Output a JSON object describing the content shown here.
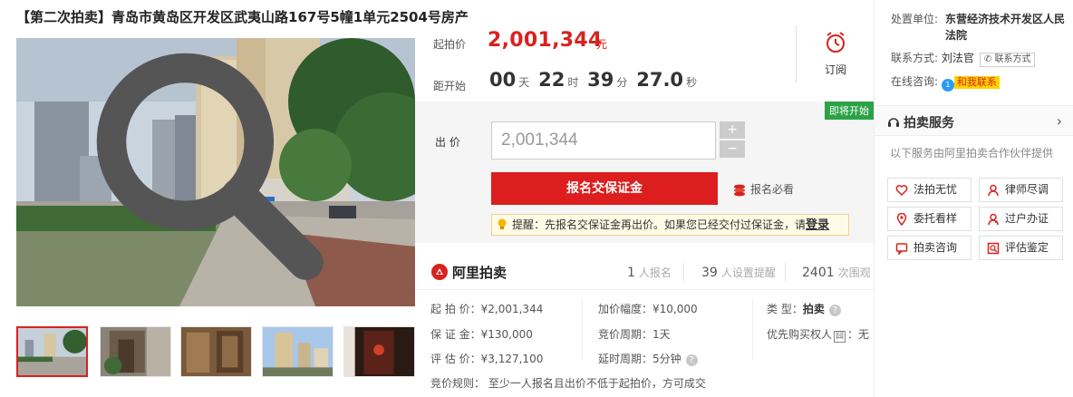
{
  "title": "【第二次拍卖】青岛市黄岛区开发区武夷山路167号5幢1单元2504号房产",
  "price": {
    "start_label": "起拍价",
    "start_value": "2,001,344",
    "unit": "元",
    "countdown_label": "距开始",
    "countdown": {
      "d": "00",
      "d_unit": "天",
      "h": "22",
      "h_unit": "时",
      "m": "39",
      "m_unit": "分",
      "s": "27.0",
      "s_unit": "秒"
    },
    "subscribe_label": "订阅"
  },
  "bid": {
    "badge": "即将开始",
    "label": "出 价",
    "value": "2,001,344",
    "plus": "+",
    "minus": "−",
    "deposit_button": "报名交保证金",
    "must_see": "报名必看",
    "reminder": "提醒：先报名交保证金再出价。如果您已经交付过保证金，请",
    "login": "登录"
  },
  "stats": {
    "logo": "阿里拍卖",
    "signups": "1",
    "signups_label": "人报名",
    "reminders": "39",
    "reminders_label": "人设置提醒",
    "views": "2401",
    "views_label": "次围观"
  },
  "info": {
    "start_price": "起 拍 价：¥2,001,344",
    "deposit": "保 证 金：¥130,000",
    "appraisal": "评 估 价：¥3,127,100",
    "increment": "加价幅度：¥10,000",
    "period": "竞价周期：1天",
    "delay": "延时周期：5分钟",
    "type_label": "类    型：",
    "type_value": "拍卖",
    "priority": "优先购买权人",
    "priority_badge": "囧",
    "priority_value": "：无",
    "rule": "竞价规则：   至少一人报名且出价不低于起拍价，方可成交",
    "help": "?"
  },
  "right": {
    "org_label": "处置单位:",
    "org_value": "东营经济技术开发区人民法院",
    "contact_label": "联系方式:",
    "contact_name": "刘法官",
    "contact_btn": "联系方式",
    "chat_label": "在线咨询:",
    "chat_badge": "1",
    "chat_btn": "和我联系",
    "service_title": "拍卖服务",
    "service_note": "以下服务由阿里拍卖合作伙伴提供",
    "services": [
      "法拍无忧",
      "律师尽调",
      "委托看样",
      "过户办证",
      "拍卖咨询",
      "评估鉴定"
    ]
  },
  "colors": {
    "accent": "#dd1e1e",
    "badge_green": "#2ba245",
    "chat_blue": "#2d9bf0"
  }
}
